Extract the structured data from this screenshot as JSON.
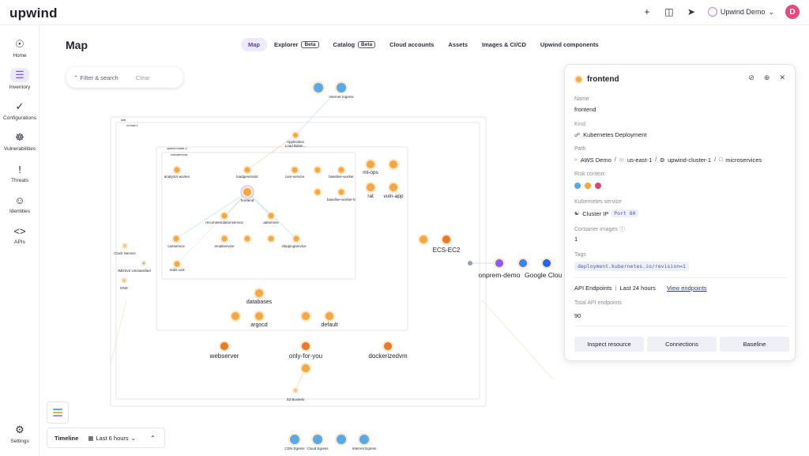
{
  "app": {
    "logo": "upwind"
  },
  "topbar": {
    "org_label": "Upwind Demo",
    "avatar_initial": "D"
  },
  "sidebar": {
    "items": [
      {
        "label": "Home",
        "icon": "home-icon"
      },
      {
        "label": "Inventory",
        "icon": "inventory-icon",
        "active": true
      },
      {
        "label": "Configurations",
        "icon": "check-icon"
      },
      {
        "label": "Vulnerabilities",
        "icon": "bug-icon"
      },
      {
        "label": "Threats",
        "icon": "alert-icon"
      },
      {
        "label": "Identities",
        "icon": "person-icon"
      },
      {
        "label": "APIs",
        "icon": "code-icon"
      },
      {
        "label": "Settings",
        "icon": "sliders-icon"
      }
    ]
  },
  "page": {
    "title": "Map"
  },
  "tabs": [
    {
      "label": "Map",
      "active": true
    },
    {
      "label": "Explorer",
      "badge": "Beta"
    },
    {
      "label": "Catalog",
      "badge": "Beta"
    },
    {
      "label": "Cloud accounts"
    },
    {
      "label": "Assets"
    },
    {
      "label": "Images & CI/CD"
    },
    {
      "label": "Upwind components"
    }
  ],
  "filter": {
    "search_label": "Filter & search",
    "clear_label": "Clear"
  },
  "map": {
    "cloud_label": "aws",
    "region_label": "us-east-1",
    "cluster_label": "upwind-cluster-1",
    "namespace_label": "microservices",
    "internet_ingress": "Internet Ingress",
    "load_balancer": "Application Load Balan...",
    "clock_service": "Clock Service",
    "imdsv2": "IMDSv2 Unclassified",
    "dns": "DNS",
    "s3": "S3 Buckets",
    "services": {
      "analytics_worker": "analytics-worker",
      "loadgenerator": "loadgenerator",
      "core_service": "core-service",
      "baseline_worker": "baseline-worker",
      "baseline_worker_tr": "baseline-worker-tr",
      "frontend": "frontend",
      "recommendationservice": "recommendationservice",
      "adservice": "adservice",
      "cartservice": "cartservice",
      "emailservice": "emailservice",
      "shippingservice": "shippingservice",
      "redis_cart": "redis-cart"
    },
    "groups": {
      "ml_ops": "ml-ops",
      "rat": "rat",
      "vuln_app": "vuln-app",
      "ecs_ec2": "ECS-EC2",
      "databases": "databases",
      "argocd": "argocd",
      "default": "default",
      "webserver": "webserver",
      "only_for_you": "only-for-you",
      "dockerizedvm": "dockerizedvm",
      "onprem_demo": "onprem-demo",
      "google_cloud": "Google Clou"
    },
    "egress": [
      "CDN Egress",
      "Cloud Egress",
      "Internet Egress"
    ]
  },
  "panel": {
    "title": "frontend",
    "name_label": "Name",
    "name_value": "frontend",
    "kind_label": "Kind",
    "kind_value": "Kubernetes Deployment",
    "path_label": "Path",
    "path_1": "AWS Demo",
    "path_2": "us-east-1",
    "path_3": "upwind-cluster-1",
    "path_4": "microservices",
    "risk_label": "Risk context",
    "k8s_label": "Kubernetes service",
    "cluster_ip": "Cluster IP",
    "port_chip": "Port 80",
    "images_label": "Container images",
    "images_value": "1",
    "tags_label": "Tags",
    "tag_value": "deployment.kubernetes.io/revision=1",
    "api_label": "API Endpoints",
    "api_window": "Last 24 hours",
    "api_link": "View endpoints",
    "total_label": "Total API endpoints",
    "total_value": "90",
    "btn_inspect": "Inspect resource",
    "btn_connections": "Connections",
    "btn_baseline": "Baseline"
  },
  "timeline": {
    "title": "Timeline",
    "range": "Last 6 hours"
  },
  "colors": {
    "accent": "#7c5ce0",
    "node": "#f5a742",
    "node_dark": "#e8792b",
    "cloud": "#5aa9e6"
  }
}
